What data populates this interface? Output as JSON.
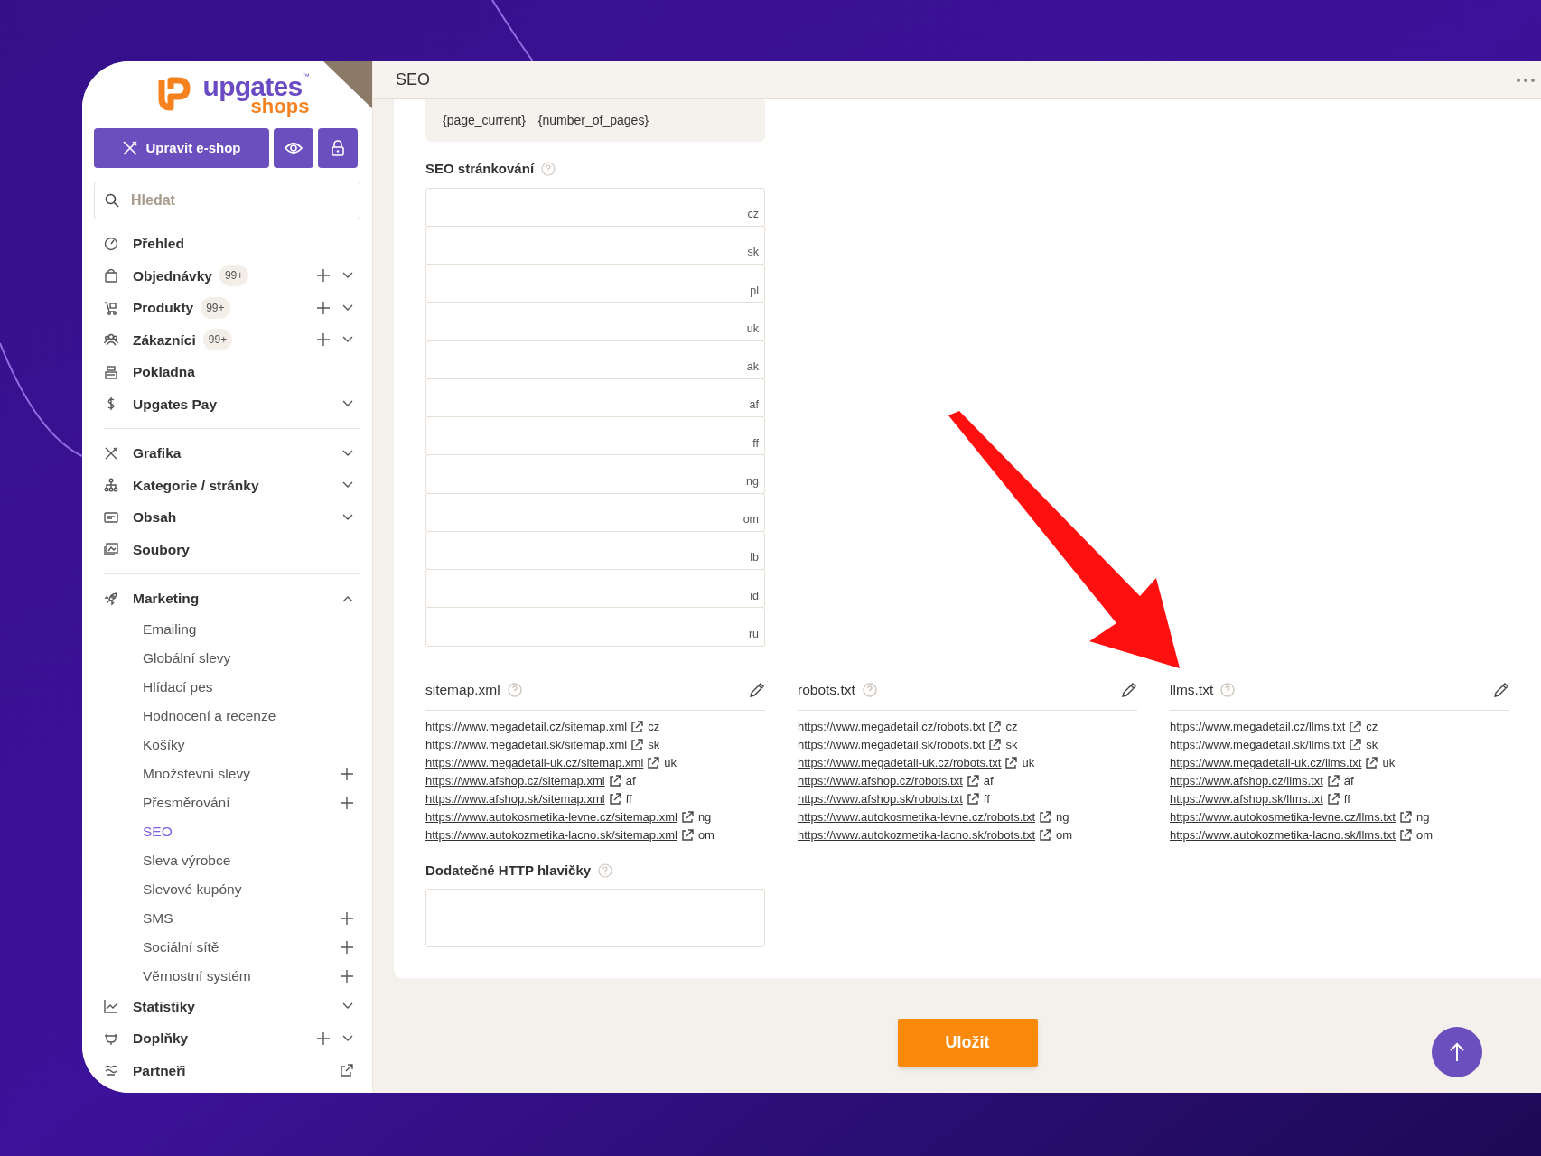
{
  "logo": {
    "word": "upgates",
    "mark": "™",
    "sub": "shops"
  },
  "sidebar": {
    "edit_button": "Upravit e-shop",
    "search": {
      "placeholder": "Hledat"
    },
    "sections": [
      {
        "items": [
          {
            "label": "Přehled",
            "selected": false
          },
          {
            "label": "Objednávky",
            "badge": "99+",
            "plus": true,
            "toggle": true,
            "expanded": false,
            "selected": false
          },
          {
            "label": "Produkty",
            "badge": "99+",
            "plus": true,
            "toggle": true,
            "expanded": false,
            "selected": false
          },
          {
            "label": "Zákazníci",
            "badge": "99+",
            "plus": true,
            "toggle": true,
            "expanded": false,
            "selected": false
          },
          {
            "label": "Pokladna",
            "selected": false
          },
          {
            "label": "Upgates Pay",
            "toggle": true,
            "expanded": false,
            "selected": false
          }
        ]
      },
      {
        "items": [
          {
            "label": "Grafika",
            "toggle": true,
            "expanded": false,
            "selected": false
          },
          {
            "label": "Kategorie / stránky",
            "toggle": true,
            "expanded": false,
            "selected": false
          },
          {
            "label": "Obsah",
            "toggle": true,
            "expanded": false,
            "selected": false
          },
          {
            "label": "Soubory",
            "selected": false
          }
        ]
      },
      {
        "items": [
          {
            "label": "Marketing",
            "toggle": true,
            "expanded": true,
            "selected": false,
            "children": [
              {
                "label": "Emailing",
                "selected": false
              },
              {
                "label": "Globální slevy",
                "selected": false
              },
              {
                "label": "Hlídací pes",
                "selected": false
              },
              {
                "label": "Hodnocení a recenze",
                "selected": false
              },
              {
                "label": "Košíky",
                "selected": false
              },
              {
                "label": "Množstevní slevy",
                "selected": false,
                "plus": true
              },
              {
                "label": "Přesměrování",
                "selected": false,
                "plus": true
              },
              {
                "label": "SEO",
                "selected": true
              },
              {
                "label": "Sleva výrobce",
                "selected": false
              },
              {
                "label": "Slevové kupóny",
                "selected": false
              },
              {
                "label": "SMS",
                "selected": false,
                "plus": true
              },
              {
                "label": "Sociální sítě",
                "selected": false,
                "plus": true
              },
              {
                "label": "Věrnostní systém",
                "selected": false,
                "plus": true
              }
            ]
          },
          {
            "label": "Statistiky",
            "toggle": true,
            "expanded": false,
            "selected": false
          },
          {
            "label": "Doplňky",
            "plus": true,
            "toggle": true,
            "expanded": false,
            "selected": false
          },
          {
            "label": "Partneři",
            "external": true,
            "selected": false
          }
        ]
      }
    ]
  },
  "header": {
    "title": "SEO"
  },
  "pagination_tokens": [
    "{page_current}",
    "{number_of_pages}"
  ],
  "seo_paging": {
    "label": "SEO stránkování",
    "fields": [
      {
        "lang": "cz"
      },
      {
        "lang": "sk"
      },
      {
        "lang": "pl"
      },
      {
        "lang": "uk"
      },
      {
        "lang": "ak"
      },
      {
        "lang": "af"
      },
      {
        "lang": "ff"
      },
      {
        "lang": "ng"
      },
      {
        "lang": "om"
      },
      {
        "lang": "lb"
      },
      {
        "lang": "id"
      },
      {
        "lang": "ru"
      }
    ]
  },
  "files": [
    {
      "title": "sitemap.xml",
      "links": [
        {
          "url": "https://www.megadetail.cz/sitemap.xml",
          "lang": "cz",
          "underlined": true
        },
        {
          "url": "https://www.megadetail.sk/sitemap.xml",
          "lang": "sk",
          "underlined": true
        },
        {
          "url": "https://www.megadetail-uk.cz/sitemap.xml",
          "lang": "uk",
          "underlined": true
        },
        {
          "url": "https://www.afshop.cz/sitemap.xml",
          "lang": "af",
          "underlined": true
        },
        {
          "url": "https://www.afshop.sk/sitemap.xml",
          "lang": "ff",
          "underlined": true
        },
        {
          "url": "https://www.autokosmetika-levne.cz/sitemap.xml",
          "lang": "ng",
          "underlined": true
        },
        {
          "url": "https://www.autokozmetika-lacno.sk/sitemap.xml",
          "lang": "om",
          "underlined": true
        }
      ]
    },
    {
      "title": "robots.txt",
      "links": [
        {
          "url": "https://www.megadetail.cz/robots.txt",
          "lang": "cz",
          "underlined": true
        },
        {
          "url": "https://www.megadetail.sk/robots.txt",
          "lang": "sk",
          "underlined": true
        },
        {
          "url": "https://www.megadetail-uk.cz/robots.txt",
          "lang": "uk",
          "underlined": true
        },
        {
          "url": "https://www.afshop.cz/robots.txt",
          "lang": "af",
          "underlined": true
        },
        {
          "url": "https://www.afshop.sk/robots.txt",
          "lang": "ff",
          "underlined": true
        },
        {
          "url": "https://www.autokosmetika-levne.cz/robots.txt",
          "lang": "ng",
          "underlined": true
        },
        {
          "url": "https://www.autokozmetika-lacno.sk/robots.txt",
          "lang": "om",
          "underlined": true
        }
      ]
    },
    {
      "title": "llms.txt",
      "links": [
        {
          "url": "https://www.megadetail.cz/llms.txt",
          "lang": "cz",
          "underlined": false
        },
        {
          "url": "https://www.megadetail.sk/llms.txt",
          "lang": "sk",
          "underlined": true
        },
        {
          "url": "https://www.megadetail-uk.cz/llms.txt",
          "lang": "uk",
          "underlined": true
        },
        {
          "url": "https://www.afshop.cz/llms.txt",
          "lang": "af",
          "underlined": true
        },
        {
          "url": "https://www.afshop.sk/llms.txt",
          "lang": "ff",
          "underlined": true
        },
        {
          "url": "https://www.autokosmetika-levne.cz/llms.txt",
          "lang": "ng",
          "underlined": true
        },
        {
          "url": "https://www.autokozmetika-lacno.sk/llms.txt",
          "lang": "om",
          "underlined": true
        }
      ]
    }
  ],
  "extra_headers": {
    "label": "Dodatečné HTTP hlavičky"
  },
  "save_button": "Uložit"
}
